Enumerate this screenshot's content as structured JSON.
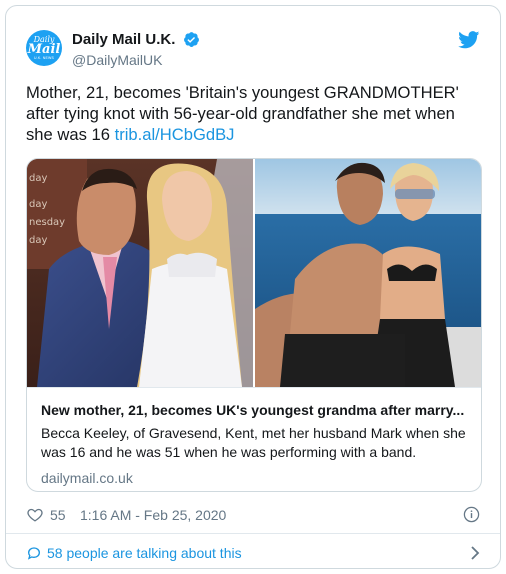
{
  "account": {
    "display_name": "Daily Mail U.K.",
    "handle": "@DailyMailUK",
    "avatar_text": {
      "line1": "Daily",
      "line2": "Mail",
      "line3": "U.K. NEWS"
    },
    "verified": true
  },
  "tweet": {
    "text": "Mother, 21, becomes 'Britain's youngest GRANDMOTHER' after tying knot with 56-year-old grandfather she met when she was 16",
    "link": "trib.al/HCbGdBJ"
  },
  "card": {
    "title": "New mother, 21, becomes UK's youngest grandma after marry...",
    "description": "Becca Keeley, of Gravesend, Kent, met her husband Mark when she was 16 and he was 51 when he was performing with a band.",
    "domain": "dailymail.co.uk",
    "sign_text": [
      "day",
      "day",
      "nesday",
      "day"
    ]
  },
  "meta": {
    "likes": "55",
    "timestamp": "1:16 AM - Feb 25, 2020"
  },
  "footer": {
    "talking": "58 people are talking about this"
  },
  "colors": {
    "twitter_blue": "#1da1f2",
    "link_blue": "#1b95e0",
    "secondary_text": "#657786",
    "border": "#cfd9de"
  },
  "icons": [
    "verified-badge-icon",
    "twitter-bird-icon",
    "heart-icon",
    "info-icon",
    "speech-bubble-icon",
    "chevron-right-icon"
  ]
}
